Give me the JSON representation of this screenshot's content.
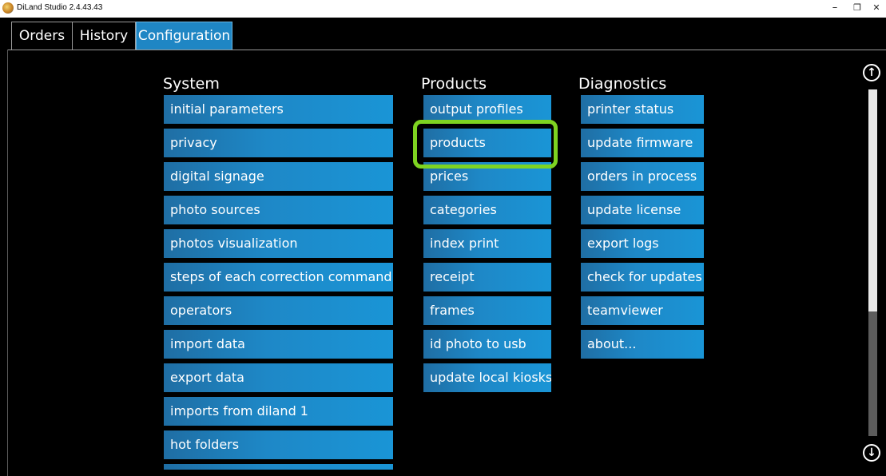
{
  "window": {
    "title": "DiLand Studio 2.4.43.43",
    "minimize": "–",
    "restore": "❐",
    "close": "✕"
  },
  "tabs": [
    {
      "label": "Orders",
      "active": false
    },
    {
      "label": "History",
      "active": false
    },
    {
      "label": "Configuration",
      "active": true
    }
  ],
  "sections": {
    "system": {
      "title": "System",
      "items": [
        "initial parameters",
        "privacy",
        "digital signage",
        "photo sources",
        "photos visualization",
        "steps of each correction command",
        "operators",
        "import data",
        "export data",
        "imports from diland 1",
        "hot folders"
      ]
    },
    "products": {
      "title": "Products",
      "items": [
        "output profiles",
        "products",
        "prices",
        "categories",
        "index print",
        "receipt",
        "frames",
        "id photo to usb",
        "update local kiosks"
      ],
      "highlighted": "products"
    },
    "diagnostics": {
      "title": "Diagnostics",
      "items": [
        "printer status",
        "update firmware",
        "orders in process",
        "update license",
        "export logs",
        "check for updates",
        "teamviewer",
        "about..."
      ]
    }
  },
  "colors": {
    "accent": "#1f86c4",
    "highlight": "#7ed321",
    "background": "#000000"
  },
  "scrollbar": {
    "up_icon": "arrow-up-circle-icon",
    "down_icon": "arrow-down-circle-icon"
  }
}
